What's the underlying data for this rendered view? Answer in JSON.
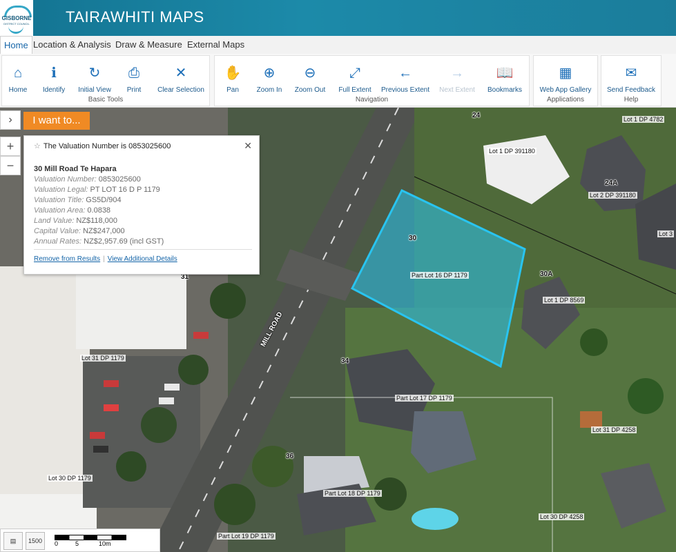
{
  "app": {
    "logo_text": "GISBORNE",
    "logo_sub": "DISTRICT COUNCIL",
    "title": "TAIRAWHITI MAPS"
  },
  "tabs": [
    {
      "label": "Home",
      "active": true
    },
    {
      "label": "Location & Analysis"
    },
    {
      "label": "Draw & Measure"
    },
    {
      "label": "External Maps"
    }
  ],
  "ribbon": {
    "groups": [
      {
        "label": "Basic Tools",
        "tools": [
          {
            "label": "Home",
            "icon": "home-icon",
            "glyph": "⌂"
          },
          {
            "label": "Identify",
            "icon": "identify-icon",
            "glyph": "ℹ"
          },
          {
            "label": "Initial View",
            "icon": "initial-view-icon",
            "glyph": "↻"
          },
          {
            "label": "Print",
            "icon": "print-icon",
            "glyph": "⎙"
          },
          {
            "label": "Clear Selection",
            "icon": "clear-icon",
            "glyph": "✕"
          }
        ]
      },
      {
        "label": "Navigation",
        "tools": [
          {
            "label": "Pan",
            "icon": "pan-hand-icon",
            "glyph": "✋"
          },
          {
            "label": "Zoom In",
            "icon": "zoom-in-icon",
            "glyph": "⊕"
          },
          {
            "label": "Zoom Out",
            "icon": "zoom-out-icon",
            "glyph": "⊖"
          },
          {
            "label": "Full Extent",
            "icon": "full-extent-icon",
            "glyph": "⤢"
          },
          {
            "label": "Previous Extent",
            "icon": "previous-extent-icon",
            "glyph": "←"
          },
          {
            "label": "Next Extent",
            "icon": "next-extent-icon",
            "glyph": "→",
            "disabled": true
          },
          {
            "label": "Bookmarks",
            "icon": "bookmarks-icon",
            "glyph": "📖"
          }
        ]
      },
      {
        "label": "Applications",
        "tools": [
          {
            "label": "Web App Gallery",
            "icon": "app-gallery-icon",
            "glyph": "▦"
          }
        ]
      },
      {
        "label": "Help",
        "tools": [
          {
            "label": "Send Feedback",
            "icon": "envelope-icon",
            "glyph": "✉"
          }
        ]
      }
    ]
  },
  "panel": {
    "expander_glyph": "›",
    "i_want_to": "I want to..."
  },
  "zoom_controls": {
    "plus": "+",
    "minus": "−"
  },
  "popup": {
    "header": "The Valuation Number is 0853025600",
    "close": "✕",
    "star": "☆",
    "title": "30 Mill Road Te Hapara",
    "rows": [
      {
        "key": "Valuation Number:",
        "value": "0853025600"
      },
      {
        "key": "Valuation Legal:",
        "value": "PT LOT 16 D P 1179"
      },
      {
        "key": "Valuation Title:",
        "value": "GS5D/904"
      },
      {
        "key": "Valuation Area:",
        "value": "0.0838"
      },
      {
        "key": "Land Value:",
        "value": "NZ$118,000"
      },
      {
        "key": "Capital Value:",
        "value": "NZ$247,000"
      },
      {
        "key": "Annual Rates:",
        "value": "NZ$2,957.69 (incl GST)"
      }
    ],
    "links": {
      "remove": "Remove from Results",
      "details": "View Additional Details"
    }
  },
  "map": {
    "road_name": "MILL ROAD",
    "house_numbers": [
      "24",
      "24A",
      "30",
      "30A",
      "31",
      "34",
      "36"
    ],
    "lot_labels": [
      "Lot 1 DP 4782",
      "Lot 1 DP 391180",
      "Lot 2 DP 391180",
      "Lot 3",
      "Part Lot 16 DP 1179",
      "Lot 1 DP 8569",
      "Lot 31 DP 1179",
      "Part Lot 17 DP 1179",
      "Lot 31 DP 4258",
      "Lot 30 DP 1179",
      "Part Lot 18 DP 1179",
      "Lot 30 DP 4258",
      "Part Lot 19 DP 1179"
    ],
    "selection_color": "#29c4f0"
  },
  "bottom": {
    "scale_text": "1500",
    "scale_labels": [
      "0",
      "5",
      "10m"
    ]
  }
}
